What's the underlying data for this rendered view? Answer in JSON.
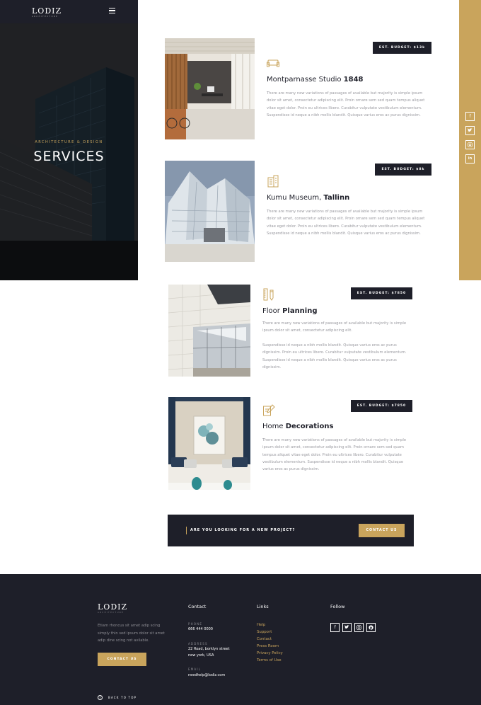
{
  "header": {
    "logo": "LODIZ",
    "logo_tagline": "ARCHITECTURE",
    "menu_icon": "hamburger-icon"
  },
  "hero": {
    "subtitle": "ARCHITECTURE & DESIGN",
    "title": "SERVICES"
  },
  "side_social": [
    "f",
    "t",
    "ig",
    "in"
  ],
  "services": [
    {
      "title_plain": "Montparnasse Studio ",
      "title_bold": "1848",
      "budget": "EST. BUDGET: $13k",
      "icon": "sofa-icon",
      "description": "There are many new variations of passages of available but majority is simple ipsum dolor sit amet, consectetur adipiscing elit. Proin ornare sem sed quam tempus aliquet vitae eget dolor. Proin eu ultrices libero. Curabitur vulputate vestibulum elementum. Suspendisse id neque a nibh mollis blandit. Quisque varius eros ac purus dignissim."
    },
    {
      "title_plain": "Kumu Museum, ",
      "title_bold": "Tallinn",
      "budget": "EST. BUDGET: $8k",
      "icon": "building-icon",
      "description": "There are many new variations of passages of available but majority is simple ipsum dolor sit amet, consectetur adipiscing elit. Proin ornare sem sed quam tempus aliquet vitae eget dolor. Proin eu ultrices libero. Curabitur vulputate vestibulum elementum. Suspendisse id neque a nibh mollis blandit. Quisque varius eros ac purus dignissim."
    },
    {
      "title_plain": "Floor ",
      "title_bold": "Planning",
      "budget": "EST. BUDGET: $7850",
      "icon": "ruler-pencil-icon",
      "description": "There are many new variations of passages of available but majority is simple ipsum dolor sit amet, consectetur adipiscing elit.",
      "description2": "Suspendisse id neque a nibh mollis blandit. Quisque varius eros ac purus dignissim. Proin eu ultrices libero. Curabitur vulputate vestibulum elementum. Suspendisse id neque a nibh mollis blandit. Quisque varius eros ac purus dignissim."
    },
    {
      "title_plain": "Home ",
      "title_bold": "Decorations",
      "budget": "EST. BUDGET: $7850",
      "icon": "pencil-document-icon",
      "description": "There are many new variations of passages of available but majority is simple ipsum dolor sit amet, consectetur adipiscing elit. Proin ornare sem sed quam tempus aliquet vitae eget dolor. Proin eu ultrices libero. Curabitur vulputate vestibulum elementum. Suspendisse id neque a nibh mollis blandit. Quisque varius eros ac purus dignissim."
    }
  ],
  "cta": {
    "text": "ARE YOU LOOKING FOR A NEW PROJECT?",
    "button": "CONTACT US"
  },
  "footer": {
    "logo": "LODIZ",
    "logo_tagline": "ARCHITECTURE",
    "about": "Etiam rhoncus sit amet adip scing simply thin sed ipsum dolor sit amet adip dine scing not avilable.",
    "about_button": "CONTACT US",
    "contact_heading": "Contact",
    "phone_label": "PHONE",
    "phone": "666 444 0000",
    "address_label": "ADDRESS",
    "address_line1": "22 Road, borklyn street",
    "address_line2": "new york, USA",
    "email_label": "EMAIL",
    "email": "needhelp@lodiz.com",
    "links_heading": "Links",
    "links": [
      "Help",
      "Support",
      "Contact",
      "Press Room",
      "Privacy Policy",
      "Terms of Use"
    ],
    "follow_heading": "Follow",
    "social": [
      "f",
      "t",
      "ig",
      "p"
    ],
    "back_to_top": "BACK TO TOP"
  },
  "colors": {
    "accent": "#c9a45c",
    "dark": "#1e1f29",
    "muted_text": "#9a9aa0"
  }
}
